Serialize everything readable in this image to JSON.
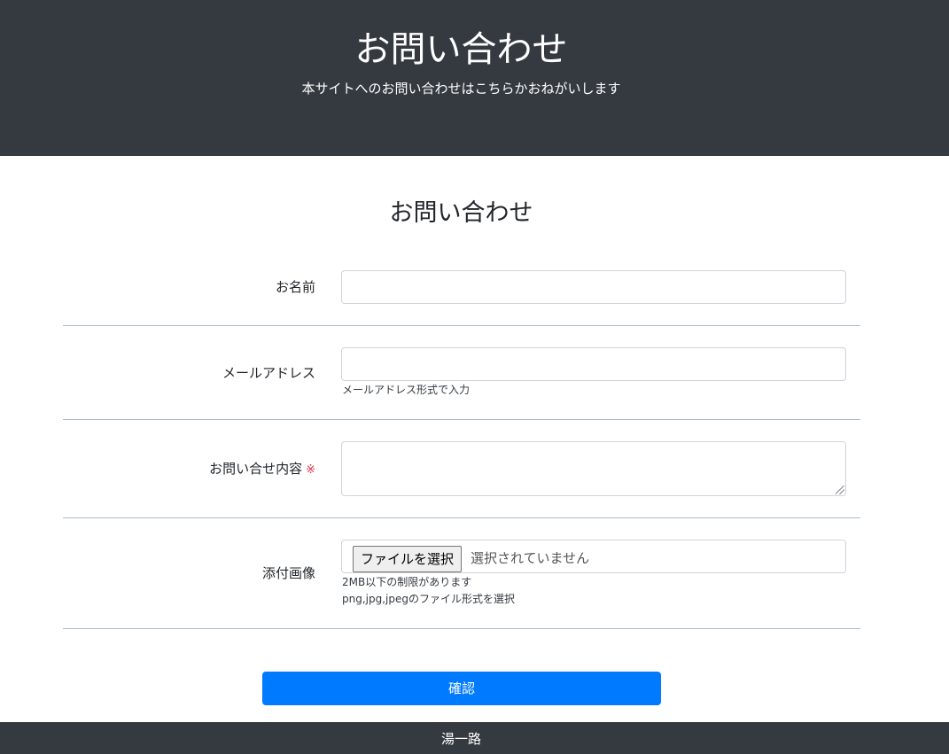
{
  "hero": {
    "title": "お問い合わせ",
    "subtitle": "本サイトへのお問い合わせはこちらかおねがいします"
  },
  "form": {
    "title": "お問い合わせ",
    "name": {
      "label": "お名前",
      "value": ""
    },
    "email": {
      "label": "メールアドレス",
      "value": "",
      "help": "メールアドレス形式で入力"
    },
    "message": {
      "label": "お問い合せ内容",
      "required_mark": "※",
      "value": ""
    },
    "image": {
      "label": "添付画像",
      "button_label": "ファイルを選択",
      "status": "選択されていません",
      "help_size": "2MB以下の制限があります",
      "help_types": "png,jpg,jpegのファイル形式を選択"
    },
    "submit_label": "確認"
  },
  "footer": {
    "text": "湯一路"
  },
  "colors": {
    "header_bg": "#343a40",
    "primary": "#007bff",
    "required": "#dc3545",
    "divider": "#a9bec9"
  }
}
